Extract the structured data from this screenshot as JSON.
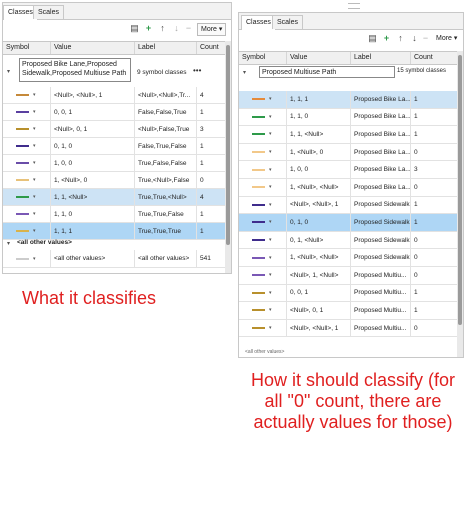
{
  "left": {
    "tabs": [
      "Classes",
      "Scales"
    ],
    "toolbar": {
      "more_label": "More"
    },
    "columns": [
      "Symbol",
      "Value",
      "Label",
      "Count"
    ],
    "heading_text": "Proposed Bike Lane,Proposed Sidewalk,Proposed Multiuse Path",
    "group_info": "9 symbol classes",
    "rows": [
      {
        "color": "#c5893a",
        "value": "<Null>, <Null>, 1",
        "label": "<Null>,<Null>,Tr...",
        "count": "4",
        "state": ""
      },
      {
        "color": "#5a3fa0",
        "value": "0, 0, 1",
        "label": "False,False,True",
        "count": "1",
        "state": ""
      },
      {
        "color": "#b8902c",
        "value": "<Null>, 0, 1",
        "label": "<Null>,False,True",
        "count": "3",
        "state": ""
      },
      {
        "color": "#3f2c8c",
        "value": "0, 1, 0",
        "label": "False,True,False",
        "count": "1",
        "state": ""
      },
      {
        "color": "#6a4da8",
        "value": "1, 0, 0",
        "label": "True,False,False",
        "count": "1",
        "state": ""
      },
      {
        "color": "#e8c27a",
        "value": "1, <Null>, 0",
        "label": "True,<Null>,False",
        "count": "0",
        "state": ""
      },
      {
        "color": "#2e9a4a",
        "value": "1, 1, <Null>",
        "label": "True,True,<Null>",
        "count": "4",
        "state": "sel"
      },
      {
        "color": "#7a58b5",
        "value": "1, 1, 0",
        "label": "True,True,False",
        "count": "1",
        "state": ""
      },
      {
        "color": "#d9b24a",
        "value": "1, 1, 1",
        "label": "True,True,True",
        "count": "1",
        "state": "sel2"
      }
    ],
    "other_heading": "<all other values>",
    "other_row": {
      "color": "#cccccc",
      "value": "<all other values>",
      "label": "<all other values>",
      "count": "541"
    }
  },
  "right": {
    "tabs": [
      "Classes",
      "Scales"
    ],
    "toolbar": {
      "more_label": "More"
    },
    "columns": [
      "Symbol",
      "Value",
      "Label",
      "Count"
    ],
    "heading_text": "Proposed Multiuse Path",
    "group_info": "15 symbol classes",
    "rows": [
      {
        "color": "#e58a3a",
        "value": "1, 1, 1",
        "label": "Proposed Bike La...",
        "count": "1",
        "state": "sel"
      },
      {
        "color": "#2e9a4a",
        "value": "1, 1, 0",
        "label": "Proposed Bike La...",
        "count": "1",
        "state": ""
      },
      {
        "color": "#2e9a4a",
        "value": "1, 1, <Null>",
        "label": "Proposed Bike La...",
        "count": "1",
        "state": ""
      },
      {
        "color": "#f2c889",
        "value": "1, <Null>, 0",
        "label": "Proposed Bike La...",
        "count": "0",
        "state": ""
      },
      {
        "color": "#f2c889",
        "value": "1, 0, 0",
        "label": "Proposed Bike La...",
        "count": "3",
        "state": ""
      },
      {
        "color": "#f2c889",
        "value": "1, <Null>, <Null>",
        "label": "Proposed Bike La...",
        "count": "0",
        "state": ""
      },
      {
        "color": "#3f2c8c",
        "value": "<Null>, <Null>, 1",
        "label": "Proposed Sidewalk",
        "count": "1",
        "state": ""
      },
      {
        "color": "#3f2c8c",
        "value": "0, 1, 0",
        "label": "Proposed Sidewalk",
        "count": "1",
        "state": "sel2"
      },
      {
        "color": "#3f2c8c",
        "value": "0, 1, <Null>",
        "label": "Proposed Sidewalk",
        "count": "0",
        "state": ""
      },
      {
        "color": "#7a58b5",
        "value": "1, <Null>, <Null>",
        "label": "Proposed Sidewalk",
        "count": "0",
        "state": ""
      },
      {
        "color": "#7a58b5",
        "value": "<Null>, 1, <Null>",
        "label": "Proposed Multiu...",
        "count": "0",
        "state": ""
      },
      {
        "color": "#b8902c",
        "value": "0, 0, 1",
        "label": "Proposed Multiu...",
        "count": "1",
        "state": ""
      },
      {
        "color": "#b8902c",
        "value": "<Null>, 0, 1",
        "label": "Proposed Multiu...",
        "count": "1",
        "state": ""
      },
      {
        "color": "#b8902c",
        "value": "<Null>, <Null>, 1",
        "label": "Proposed Multiu...",
        "count": "0",
        "state": ""
      }
    ],
    "other_heading": "<all other values>"
  },
  "captions": {
    "left": "What it classifies",
    "right": "How it should classify (for all \"0\" count, there are actually values for those)"
  }
}
